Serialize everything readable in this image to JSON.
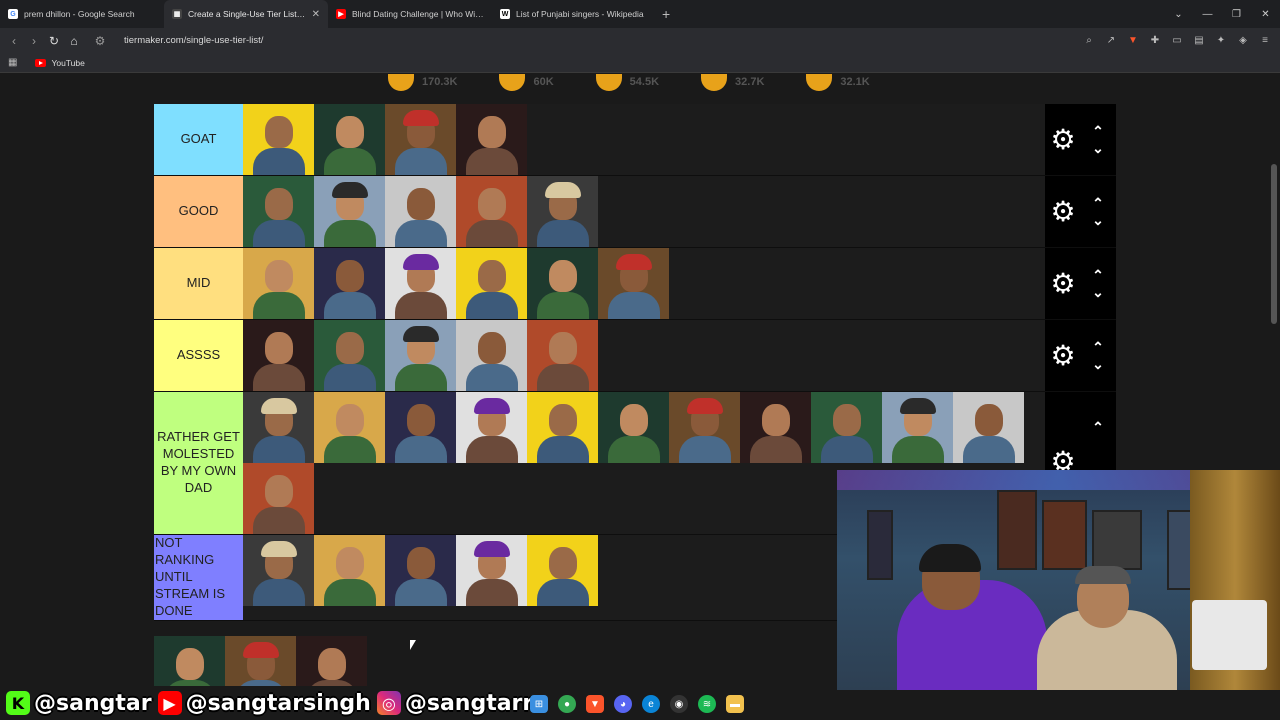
{
  "browser": {
    "tabs": [
      {
        "label": "prem dhillon - Google Search",
        "icon": "google-icon",
        "color": "#ffffff"
      },
      {
        "label": "Create a Single-Use Tier List (Pri",
        "icon": "tiermaker-icon",
        "color": "#333333",
        "active": true
      },
      {
        "label": "Blind Dating Challenge | Who Will K",
        "icon": "youtube-icon",
        "color": "#ff0000"
      },
      {
        "label": "List of Punjabi singers - Wikipedia",
        "icon": "wikipedia-icon",
        "color": "#ffffff"
      }
    ],
    "url": "tiermaker.com/single-use-tier-list/",
    "bookmark": "YouTube"
  },
  "reactions": [
    {
      "count": "170.3K",
      "color": "#e8a21a"
    },
    {
      "count": "60K",
      "color": "#e8a21a"
    },
    {
      "count": "54.5K",
      "color": "#e8a21a"
    },
    {
      "count": "32.7K",
      "color": "#e8a21a"
    },
    {
      "count": "32.1K",
      "color": "#e8a21a"
    }
  ],
  "tiers": [
    {
      "label": "GOAT",
      "color": "#7fdfff",
      "items": 4
    },
    {
      "label": "GOOD",
      "color": "#ffbf7f",
      "items": 5
    },
    {
      "label": "MID",
      "color": "#ffdf7f",
      "items": 6
    },
    {
      "label": "ASSSS",
      "color": "#ffff7f",
      "items": 5
    },
    {
      "label": "RATHER GET MOLESTED BY MY OWN DAD",
      "color": "#bfff7f",
      "items": 12
    },
    {
      "label": "NOT RANKING UNTIL STREAM IS DONE",
      "color": "#7f7fff",
      "items": 5
    }
  ],
  "pool_items": 3,
  "overlay": {
    "kick": "@sangtar",
    "youtube": "@sangtarsingh",
    "instagram": "@sangtarr"
  },
  "colors": {
    "page_bg": "#1a1a1a",
    "control_bg": "#000000",
    "tab_bar": "#1e1f22",
    "toolbar": "#2b2c30"
  }
}
